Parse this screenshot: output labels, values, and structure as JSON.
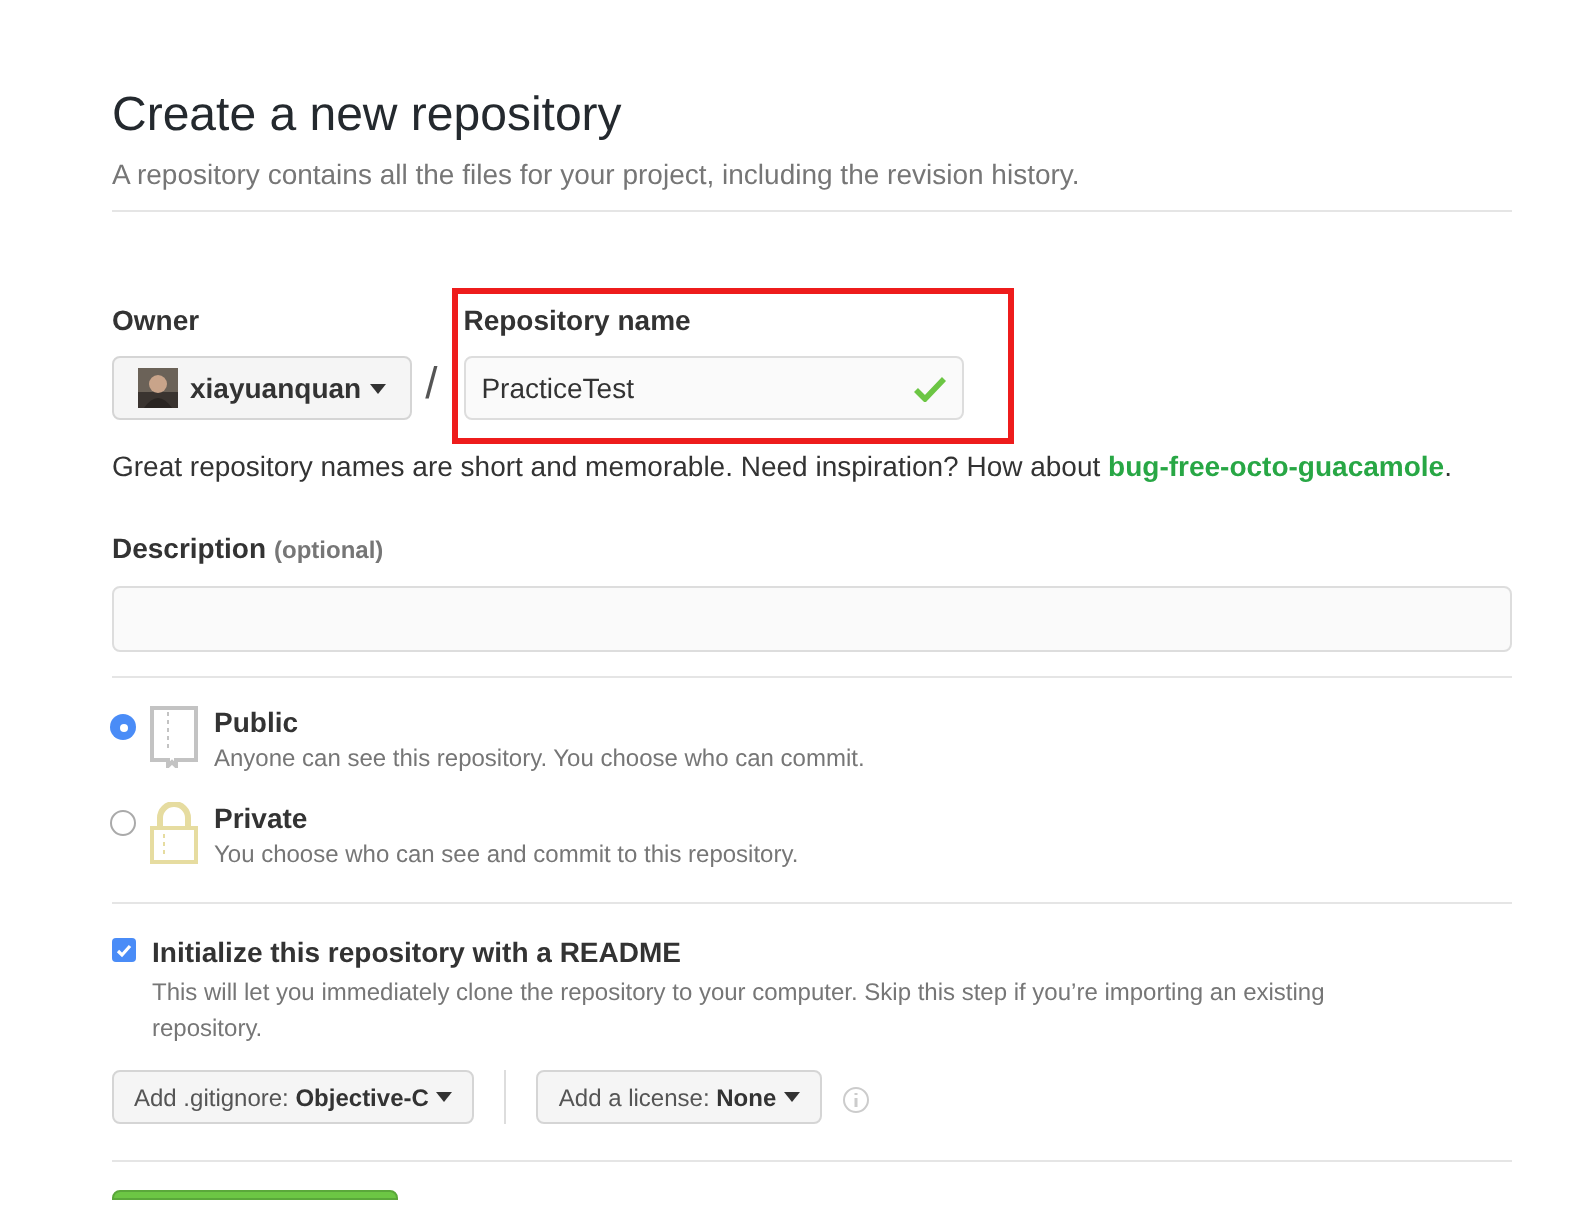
{
  "title": "Create a new repository",
  "subtitle": "A repository contains all the files for your project, including the revision history.",
  "owner": {
    "label": "Owner",
    "value": "xiayuanquan"
  },
  "separator": "/",
  "repo_name": {
    "label": "Repository name",
    "value": "PracticeTest",
    "valid": true,
    "highlighted": true
  },
  "hint": {
    "text": "Great repository names are short and memorable. Need inspiration? How about",
    "suggestion": "bug-free-octo-guacamole",
    "end": "."
  },
  "description": {
    "label": "Description",
    "optional": "(optional)"
  },
  "visibility": [
    {
      "kind": "public",
      "label": "Public",
      "note": "Anyone can see this repository. You choose who can commit.",
      "selected": true
    },
    {
      "kind": "private",
      "label": "Private",
      "note": "You choose who can see and commit to this repository.",
      "selected": false
    }
  ],
  "readme": {
    "label": "Initialize this repository with a README",
    "note": "This will let you immediately clone the repository to your computer. Skip this step if you’re importing an existing repository.",
    "checked": true
  },
  "gitignore": {
    "label": "Add .gitignore:",
    "value": "Objective-C"
  },
  "license": {
    "label": "Add a license:",
    "value": "None"
  }
}
